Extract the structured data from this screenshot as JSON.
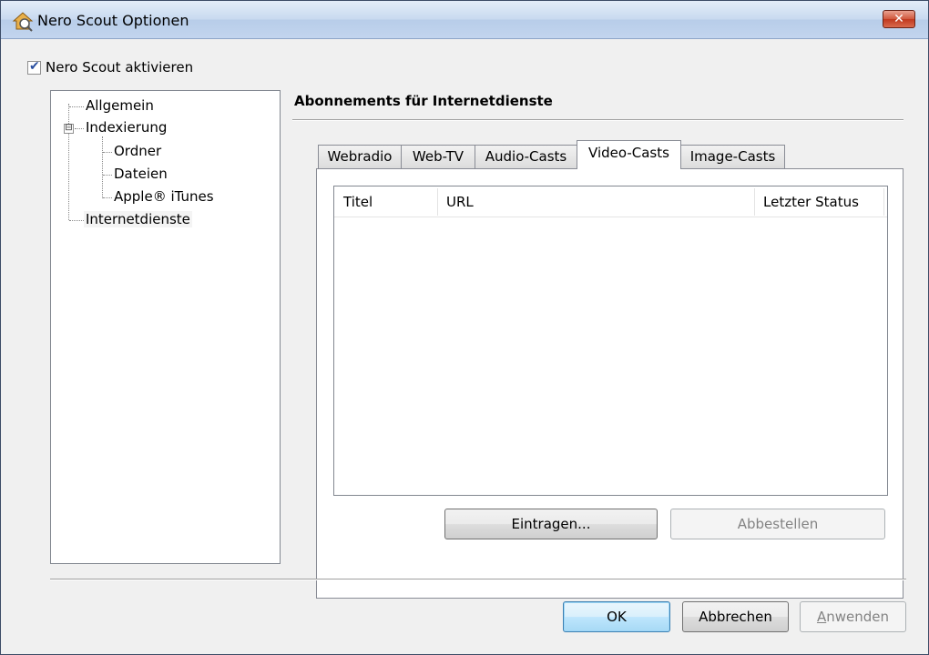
{
  "window": {
    "title": "Nero Scout Optionen",
    "close_label": "✕"
  },
  "enable_checkbox": {
    "label": "Nero Scout aktivieren",
    "checked": true
  },
  "tree": {
    "items": [
      {
        "label": "Allgemein"
      },
      {
        "label": "Indexierung",
        "expander": "⊟"
      },
      {
        "label": "Ordner"
      },
      {
        "label": "Dateien"
      },
      {
        "label": "Apple® iTunes"
      },
      {
        "label": "Internetdienste",
        "selected": true
      }
    ]
  },
  "panel": {
    "title": "Abonnements für Internetdienste"
  },
  "tabs": [
    {
      "label": "Webradio"
    },
    {
      "label": "Web-TV"
    },
    {
      "label": "Audio-Casts"
    },
    {
      "label": "Video-Casts",
      "active": true
    },
    {
      "label": "Image-Casts"
    }
  ],
  "list": {
    "columns": [
      "Titel",
      "URL",
      "Letzter Status"
    ],
    "rows": []
  },
  "buttons": {
    "subscribe": "Eintragen...",
    "unsubscribe": "Abbestellen",
    "ok": "OK",
    "cancel": "Abbrechen",
    "apply_prefix": "",
    "apply_mnemonic": "A",
    "apply_rest": "nwenden"
  },
  "colors": {
    "accent": "#3c7fb1",
    "disabled_text": "#838383"
  }
}
